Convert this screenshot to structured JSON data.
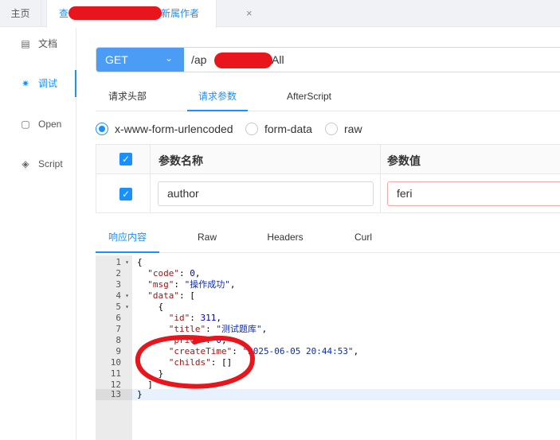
{
  "tabs": {
    "home_label": "主页",
    "active_prefix": "查",
    "active_suffix": "新属作者",
    "close_glyph": "×"
  },
  "sidenav": [
    {
      "label": "文档",
      "icon": "document-icon",
      "glyph": "▤"
    },
    {
      "label": "调试",
      "icon": "bug-icon",
      "glyph": "✷",
      "active": true
    },
    {
      "label": "Open",
      "icon": "file-icon",
      "glyph": "▢"
    },
    {
      "label": "Script",
      "icon": "code-cube-icon",
      "glyph": "◈"
    }
  ],
  "request": {
    "method": "GET",
    "method_chevron": "⌄",
    "url_prefix": "/ap",
    "url_suffix": "All"
  },
  "request_tabs": [
    "请求头部",
    "请求参数",
    "AfterScript"
  ],
  "content_types": [
    "x-www-form-urlencoded",
    "form-data",
    "raw"
  ],
  "params_table": {
    "headers": [
      "参数名称",
      "参数值"
    ],
    "rows": [
      {
        "checked": true,
        "name": "author",
        "value": "feri"
      }
    ]
  },
  "response_tabs": [
    "响应内容",
    "Raw",
    "Headers",
    "Curl"
  ],
  "code_lines": [
    {
      "num": "1",
      "fold": "▾"
    },
    {
      "num": "2",
      "fold": ""
    },
    {
      "num": "3",
      "fold": ""
    },
    {
      "num": "4",
      "fold": "▾"
    },
    {
      "num": "5",
      "fold": "▾"
    },
    {
      "num": "6",
      "fold": ""
    },
    {
      "num": "7",
      "fold": ""
    },
    {
      "num": "8",
      "fold": ""
    },
    {
      "num": "9",
      "fold": ""
    },
    {
      "num": "10",
      "fold": ""
    },
    {
      "num": "11",
      "fold": ""
    },
    {
      "num": "12",
      "fold": ""
    },
    {
      "num": "13",
      "fold": ""
    }
  ],
  "code": {
    "code_value": "0",
    "msg_value": "\"操作成功\"",
    "id_value": "311",
    "title_value": "\"测试题库\"",
    "price_value": "0",
    "create_time_value": "\"2025-06-05 20:44:53\"",
    "childs_value": "[]"
  },
  "colors": {
    "accent": "#1890ff",
    "method_bg": "#4a9cf5",
    "redaction": "#e8161c",
    "annotation": "#e8161c"
  }
}
